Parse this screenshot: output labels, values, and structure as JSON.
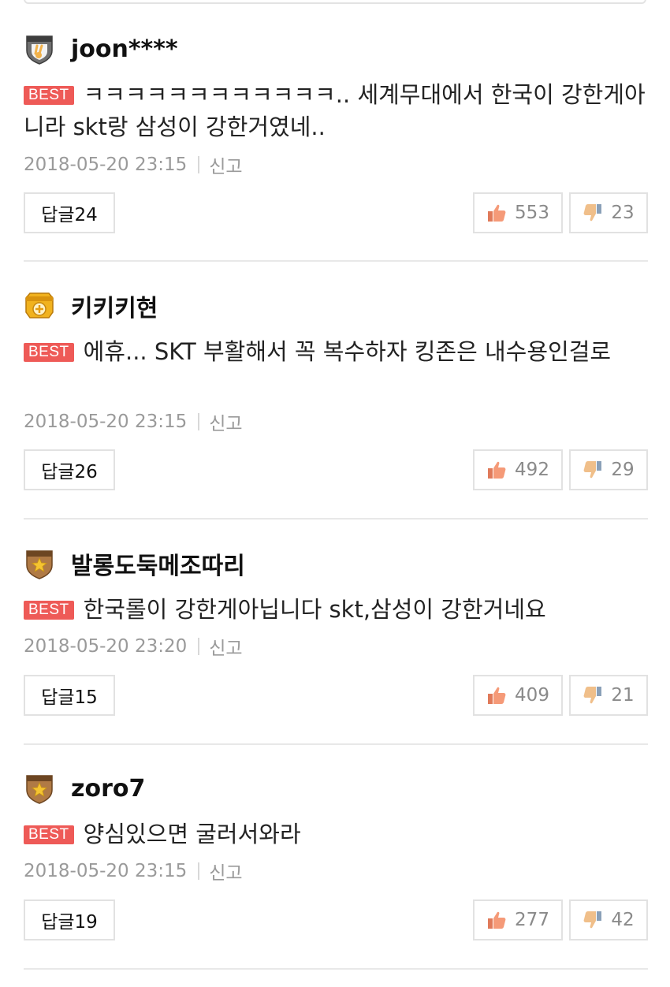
{
  "comments": [
    {
      "badge": "rookie-badge-icon",
      "username": "joon****",
      "best_label": "BEST",
      "text": "ㅋㅋㅋㅋㅋㅋㅋㅋㅋㅋㅋㅋ.. 세계무대에서 한국이 강한게아니라 skt랑 삼성이 강한거였네..",
      "date": "2018-05-20 23:15",
      "report_label": "신고",
      "reply_label": "답글24",
      "likes": "553",
      "dislikes": "23"
    },
    {
      "badge": "master-badge-icon",
      "username": "키키키현",
      "best_label": "BEST",
      "text": "에휴... SKT 부활해서 꼭 복수하자 킹존은 내수용인걸로",
      "date": "2018-05-20 23:15",
      "report_label": "신고",
      "reply_label": "답글26",
      "likes": "492",
      "dislikes": "29"
    },
    {
      "badge": "senior-badge-icon",
      "username": "발롱도둑메조따리",
      "best_label": "BEST",
      "text": "한국롤이 강한게아닙니다 skt,삼성이 강한거네요",
      "date": "2018-05-20 23:20",
      "report_label": "신고",
      "reply_label": "답글15",
      "likes": "409",
      "dislikes": "21"
    },
    {
      "badge": "senior-badge-icon",
      "username": "zoro7",
      "best_label": "BEST",
      "text": "양심있으면 굴러서와라",
      "date": "2018-05-20 23:15",
      "report_label": "신고",
      "reply_label": "답글19",
      "likes": "277",
      "dislikes": "42"
    }
  ],
  "colors": {
    "best_tag": "#ee5a57",
    "meta_text": "#9a9a9a",
    "border": "#e2e2e2",
    "thumb": "#f08a6a",
    "thumb_down": "#e8b080"
  }
}
